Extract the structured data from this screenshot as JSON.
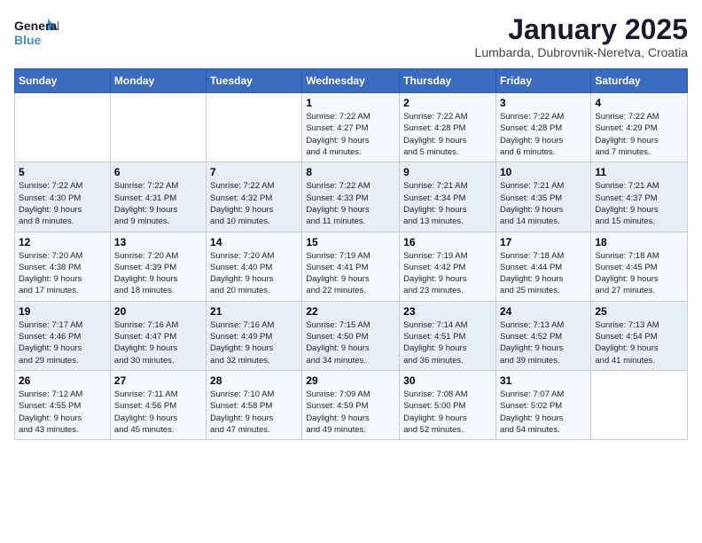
{
  "header": {
    "logo_line1": "General",
    "logo_line2": "Blue",
    "month": "January 2025",
    "location": "Lumbarda, Dubrovnik-Neretva, Croatia"
  },
  "days_of_week": [
    "Sunday",
    "Monday",
    "Tuesday",
    "Wednesday",
    "Thursday",
    "Friday",
    "Saturday"
  ],
  "weeks": [
    [
      {
        "day": "",
        "text": ""
      },
      {
        "day": "",
        "text": ""
      },
      {
        "day": "",
        "text": ""
      },
      {
        "day": "1",
        "text": "Sunrise: 7:22 AM\nSunset: 4:27 PM\nDaylight: 9 hours\nand 4 minutes."
      },
      {
        "day": "2",
        "text": "Sunrise: 7:22 AM\nSunset: 4:28 PM\nDaylight: 9 hours\nand 5 minutes."
      },
      {
        "day": "3",
        "text": "Sunrise: 7:22 AM\nSunset: 4:28 PM\nDaylight: 9 hours\nand 6 minutes."
      },
      {
        "day": "4",
        "text": "Sunrise: 7:22 AM\nSunset: 4:29 PM\nDaylight: 9 hours\nand 7 minutes."
      }
    ],
    [
      {
        "day": "5",
        "text": "Sunrise: 7:22 AM\nSunset: 4:30 PM\nDaylight: 9 hours\nand 8 minutes."
      },
      {
        "day": "6",
        "text": "Sunrise: 7:22 AM\nSunset: 4:31 PM\nDaylight: 9 hours\nand 9 minutes."
      },
      {
        "day": "7",
        "text": "Sunrise: 7:22 AM\nSunset: 4:32 PM\nDaylight: 9 hours\nand 10 minutes."
      },
      {
        "day": "8",
        "text": "Sunrise: 7:22 AM\nSunset: 4:33 PM\nDaylight: 9 hours\nand 11 minutes."
      },
      {
        "day": "9",
        "text": "Sunrise: 7:21 AM\nSunset: 4:34 PM\nDaylight: 9 hours\nand 13 minutes."
      },
      {
        "day": "10",
        "text": "Sunrise: 7:21 AM\nSunset: 4:35 PM\nDaylight: 9 hours\nand 14 minutes."
      },
      {
        "day": "11",
        "text": "Sunrise: 7:21 AM\nSunset: 4:37 PM\nDaylight: 9 hours\nand 15 minutes."
      }
    ],
    [
      {
        "day": "12",
        "text": "Sunrise: 7:20 AM\nSunset: 4:38 PM\nDaylight: 9 hours\nand 17 minutes."
      },
      {
        "day": "13",
        "text": "Sunrise: 7:20 AM\nSunset: 4:39 PM\nDaylight: 9 hours\nand 18 minutes."
      },
      {
        "day": "14",
        "text": "Sunrise: 7:20 AM\nSunset: 4:40 PM\nDaylight: 9 hours\nand 20 minutes."
      },
      {
        "day": "15",
        "text": "Sunrise: 7:19 AM\nSunset: 4:41 PM\nDaylight: 9 hours\nand 22 minutes."
      },
      {
        "day": "16",
        "text": "Sunrise: 7:19 AM\nSunset: 4:42 PM\nDaylight: 9 hours\nand 23 minutes."
      },
      {
        "day": "17",
        "text": "Sunrise: 7:18 AM\nSunset: 4:44 PM\nDaylight: 9 hours\nand 25 minutes."
      },
      {
        "day": "18",
        "text": "Sunrise: 7:18 AM\nSunset: 4:45 PM\nDaylight: 9 hours\nand 27 minutes."
      }
    ],
    [
      {
        "day": "19",
        "text": "Sunrise: 7:17 AM\nSunset: 4:46 PM\nDaylight: 9 hours\nand 29 minutes."
      },
      {
        "day": "20",
        "text": "Sunrise: 7:16 AM\nSunset: 4:47 PM\nDaylight: 9 hours\nand 30 minutes."
      },
      {
        "day": "21",
        "text": "Sunrise: 7:16 AM\nSunset: 4:49 PM\nDaylight: 9 hours\nand 32 minutes."
      },
      {
        "day": "22",
        "text": "Sunrise: 7:15 AM\nSunset: 4:50 PM\nDaylight: 9 hours\nand 34 minutes."
      },
      {
        "day": "23",
        "text": "Sunrise: 7:14 AM\nSunset: 4:51 PM\nDaylight: 9 hours\nand 36 minutes."
      },
      {
        "day": "24",
        "text": "Sunrise: 7:13 AM\nSunset: 4:52 PM\nDaylight: 9 hours\nand 39 minutes."
      },
      {
        "day": "25",
        "text": "Sunrise: 7:13 AM\nSunset: 4:54 PM\nDaylight: 9 hours\nand 41 minutes."
      }
    ],
    [
      {
        "day": "26",
        "text": "Sunrise: 7:12 AM\nSunset: 4:55 PM\nDaylight: 9 hours\nand 43 minutes."
      },
      {
        "day": "27",
        "text": "Sunrise: 7:11 AM\nSunset: 4:56 PM\nDaylight: 9 hours\nand 45 minutes."
      },
      {
        "day": "28",
        "text": "Sunrise: 7:10 AM\nSunset: 4:58 PM\nDaylight: 9 hours\nand 47 minutes."
      },
      {
        "day": "29",
        "text": "Sunrise: 7:09 AM\nSunset: 4:59 PM\nDaylight: 9 hours\nand 49 minutes."
      },
      {
        "day": "30",
        "text": "Sunrise: 7:08 AM\nSunset: 5:00 PM\nDaylight: 9 hours\nand 52 minutes."
      },
      {
        "day": "31",
        "text": "Sunrise: 7:07 AM\nSunset: 5:02 PM\nDaylight: 9 hours\nand 54 minutes."
      },
      {
        "day": "",
        "text": ""
      }
    ]
  ]
}
